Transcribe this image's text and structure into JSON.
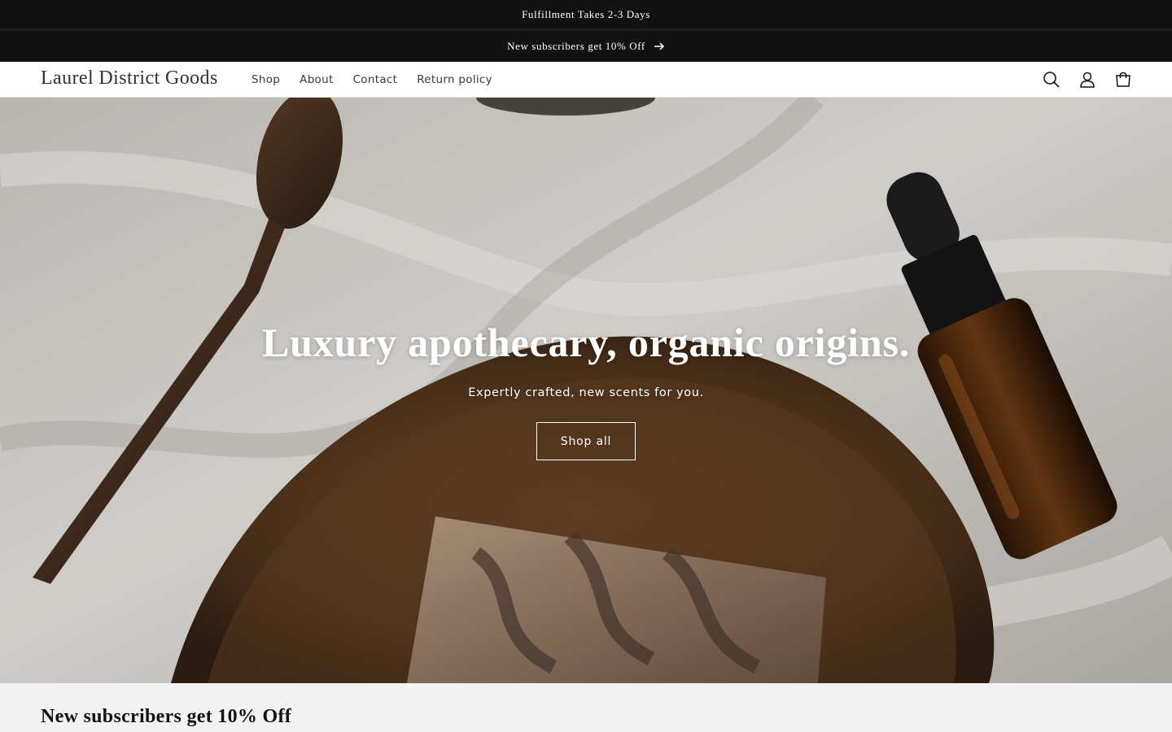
{
  "announcements": {
    "primary": "Fulfillment Takes 2-3 Days",
    "secondary": "New subscribers get 10% Off",
    "secondary_icon": "arrow-right-icon"
  },
  "header": {
    "logo": "Laurel District Goods",
    "nav": [
      "Shop",
      "About",
      "Contact",
      "Return policy"
    ],
    "icons": [
      "search-icon",
      "account-icon",
      "cart-icon"
    ]
  },
  "hero": {
    "heading": "Luxury apothecary, organic origins.",
    "subheading": "Expertly crafted, new scents for you.",
    "button_label": "Shop all"
  },
  "newsletter": {
    "heading": "New subscribers get 10% Off"
  },
  "colors": {
    "announcement_bg": "#121212",
    "announcement_text": "#ffffff",
    "header_bg": "#ffffff",
    "newsletter_bg": "#f3f3f3"
  }
}
